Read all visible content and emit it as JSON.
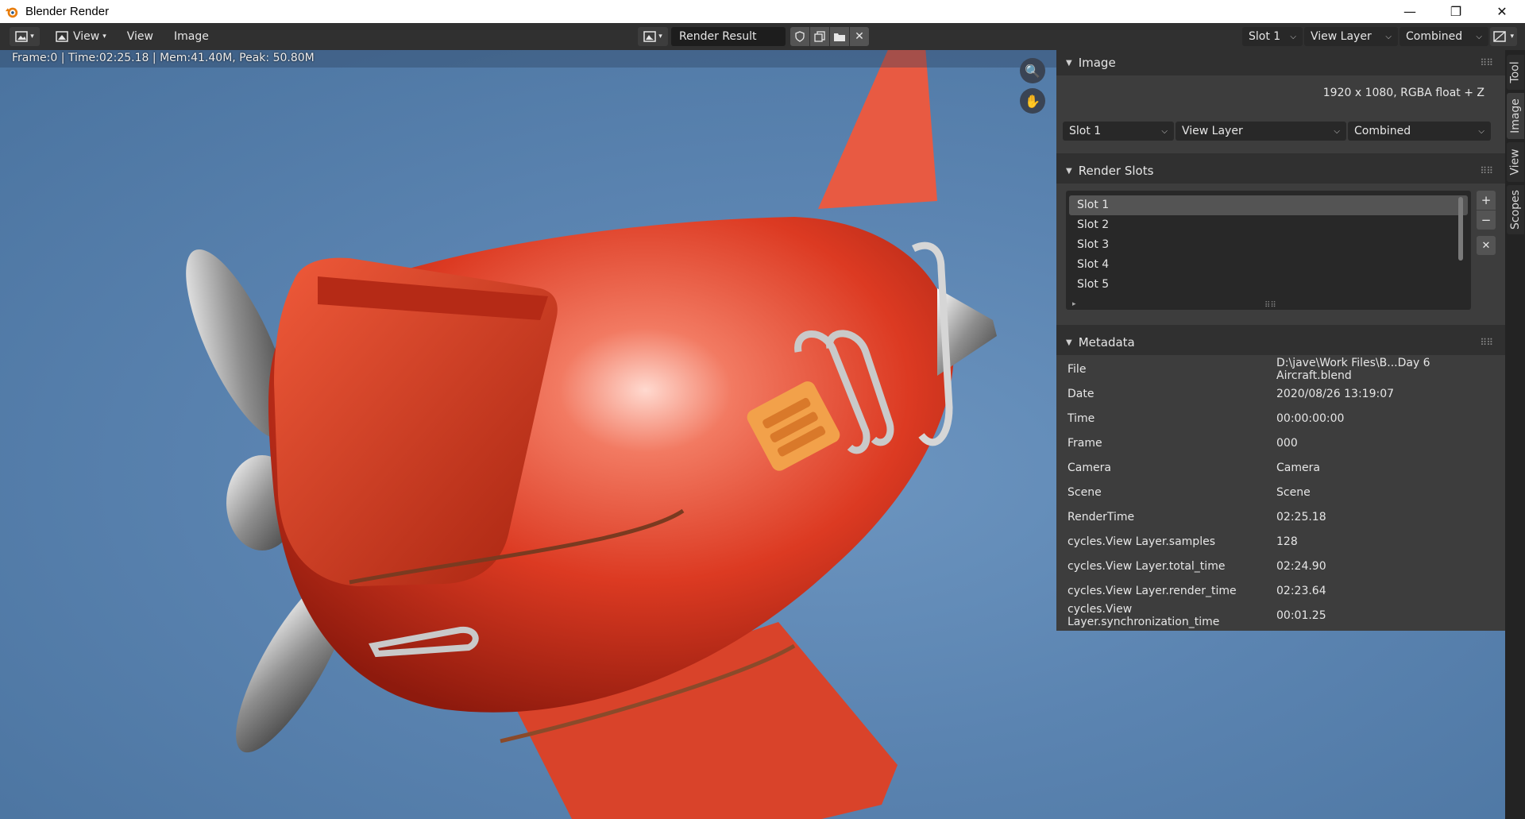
{
  "window": {
    "title": "Blender Render",
    "controls": [
      "—",
      "❐",
      "✕"
    ]
  },
  "header": {
    "menus": [
      "View",
      "View",
      "Image"
    ],
    "image_name": "Render Result",
    "slot": "Slot 1",
    "view_layer": "View Layer",
    "pass": "Combined"
  },
  "viewport": {
    "status": "Frame:0 | Time:02:25.18 | Mem:41.40M, Peak: 50.80M"
  },
  "sidebar": {
    "image_panel": {
      "title": "Image",
      "resolution": "1920 x 1080,  RGBA float + Z",
      "slot": "Slot 1",
      "view_layer": "View Layer",
      "pass": "Combined"
    },
    "render_slots": {
      "title": "Render Slots",
      "slots": [
        "Slot 1",
        "Slot 2",
        "Slot 3",
        "Slot 4",
        "Slot 5"
      ]
    },
    "metadata": {
      "title": "Metadata",
      "rows": [
        {
          "key": "File",
          "value": "D:\\jave\\Work Files\\B...Day 6 Aircraft.blend"
        },
        {
          "key": "Date",
          "value": "2020/08/26 13:19:07"
        },
        {
          "key": "Time",
          "value": "00:00:00:00"
        },
        {
          "key": "Frame",
          "value": "000"
        },
        {
          "key": "Camera",
          "value": "Camera"
        },
        {
          "key": "Scene",
          "value": "Scene"
        },
        {
          "key": "RenderTime",
          "value": "02:25.18"
        },
        {
          "key": "cycles.View Layer.samples",
          "value": "128"
        },
        {
          "key": "cycles.View Layer.total_time",
          "value": "02:24.90"
        },
        {
          "key": "cycles.View Layer.render_time",
          "value": "02:23.64"
        },
        {
          "key": "cycles.View Layer.synchronization_time",
          "value": "00:01.25"
        }
      ]
    }
  },
  "tabs": [
    "Tool",
    "Image",
    "View",
    "Scopes"
  ]
}
